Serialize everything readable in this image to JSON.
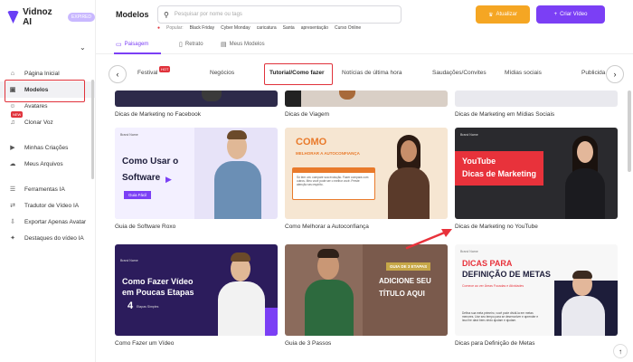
{
  "sidebar": {
    "logo": "Vidnoz AI",
    "plan_badge": "EXPIRED",
    "items": [
      {
        "label": "Página Inicial",
        "icon": "home-icon",
        "glyph": "⌂"
      },
      {
        "label": "Modelos",
        "icon": "template-icon",
        "glyph": "▣"
      },
      {
        "label": "Avatares",
        "icon": "avatar-icon",
        "glyph": "☺"
      },
      {
        "label": "Clonar Voz",
        "icon": "voice-icon",
        "glyph": "♫",
        "badge": "NEW"
      },
      {
        "label": "Minhas Criações",
        "icon": "video-icon",
        "glyph": "▶"
      },
      {
        "label": "Meus Arquivos",
        "icon": "folder-icon",
        "glyph": "☁"
      },
      {
        "label": "Ferramentas IA",
        "icon": "tools-icon",
        "glyph": "☰"
      },
      {
        "label": "Tradutor de Vídeo IA",
        "icon": "translate-icon",
        "glyph": "⇄"
      },
      {
        "label": "Exportar Apenas Avatar",
        "icon": "export-icon",
        "glyph": "⇩"
      },
      {
        "label": "Destaques do vídeo IA",
        "icon": "highlight-icon",
        "glyph": "✦"
      }
    ]
  },
  "header": {
    "title": "Modelos",
    "search_placeholder": "Pesquisar por nome ou tags",
    "popular_label": "Popular:",
    "popular_tags": [
      "Black Friday",
      "Cyber Monday",
      "caricatura",
      "Santa",
      "apresentação",
      "Curso Online"
    ],
    "upgrade_label": "Atualizar",
    "create_label": "Criar Vídeo"
  },
  "category_tabs": [
    {
      "label": "Paisagem",
      "icon": "landscape-icon"
    },
    {
      "label": "Retrato",
      "icon": "portrait-icon"
    },
    {
      "label": "Meus Modelos",
      "icon": "mytemplates-icon"
    }
  ],
  "sub_tabs": [
    "Festival",
    "Negócios",
    "Tutorial/Como fazer",
    "Notícias de última hora",
    "Saudações/Convites",
    "Mídias sociais",
    "Publicida"
  ],
  "hot_badge": "HOT",
  "cards": {
    "row0": [
      "Dicas de Marketing no Facebook",
      "Dicas de Viagem",
      "Dicas de Marketing em Mídias Sociais"
    ],
    "row1": [
      {
        "title": "Guia de Software Roxo",
        "brand": "Brand Name",
        "line1": "Como Usar o",
        "line2": "Software",
        "chip": "Guia Fácil"
      },
      {
        "title": "Como Melhorar a Autoconfiança",
        "line1": "COMO",
        "line2": "MELHORAR A AUTOCONFIANÇA",
        "note": "Só tem um: compare sua evolução. Fazer compara com outros. Meu você pode ser o melhor você. Preste atenção seu espírito."
      },
      {
        "title": "Dicas de Marketing no YouTube",
        "brand": "Brand Name",
        "line1": "YouTube",
        "line2": "Dicas de Marketing"
      }
    ],
    "row2": [
      {
        "title": "Como Fazer um Vídeo",
        "brand": "Brand Name",
        "line1": "Como Fazer Vídeo",
        "line2": "em Poucas Etapas",
        "step": "4",
        "step_label": "Etapas Simples"
      },
      {
        "title": "Guia de 3 Passos",
        "chip": "GUIA DE 3 ETAPAS",
        "line1": "ADICIONE SEU",
        "line2": "TÍTULO AQUI"
      },
      {
        "title": "Dicas para Definição de Metas",
        "brand": "Brand Name",
        "line1": "DICAS PARA",
        "line2": "DEFINIÇÃO DE METAS",
        "sub": "Comece ao ver Áreas Focadas e Atividades",
        "body": "Defina sua meta primeiro, você pode dividi-la em metas menores. Use seu tempo para se desenvolver e aprender e isso lhe dará bem-vindo ajudam e ajudam."
      }
    ]
  },
  "colors": {
    "accent": "#7b3ff5",
    "highlight": "#e0323b",
    "upgrade": "#f5a623"
  }
}
